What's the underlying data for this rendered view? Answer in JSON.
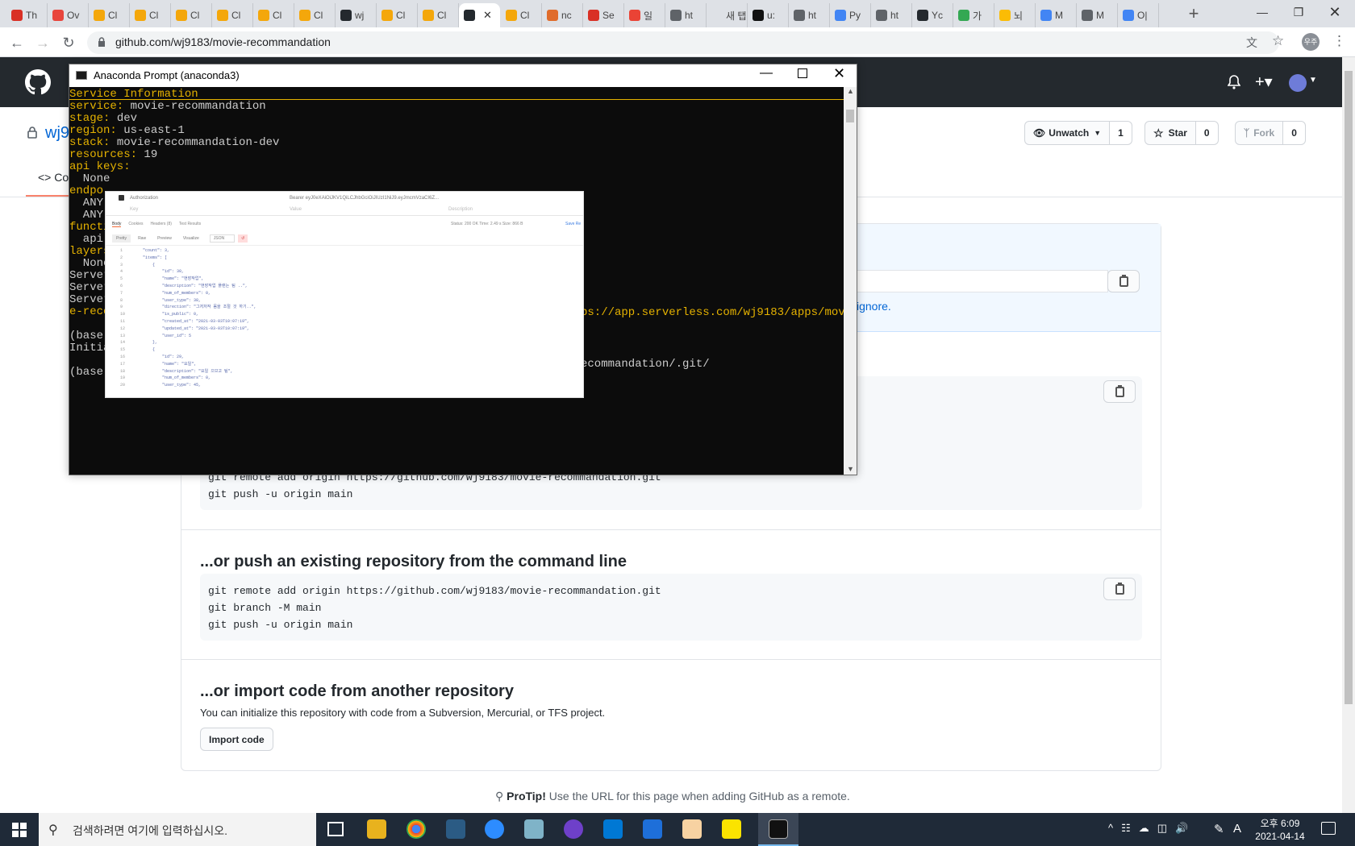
{
  "browser": {
    "tabs": [
      {
        "label": "Th",
        "color": "#d93025"
      },
      {
        "label": "Ov",
        "color": "#e8453c"
      },
      {
        "label": "Cl",
        "color": "#f4a70b"
      },
      {
        "label": "Cl",
        "color": "#f4a70b"
      },
      {
        "label": "Cl",
        "color": "#f4a70b"
      },
      {
        "label": "Cl",
        "color": "#f4a70b"
      },
      {
        "label": "Cl",
        "color": "#f4a70b"
      },
      {
        "label": "Cl",
        "color": "#f4a70b"
      },
      {
        "label": "wj",
        "color": "#24292e"
      },
      {
        "label": "Cl",
        "color": "#f4a70b"
      },
      {
        "label": "Cl",
        "color": "#f4a70b"
      },
      {
        "label": "",
        "color": "#24292e",
        "active": true
      },
      {
        "label": "Cl",
        "color": "#f4a70b"
      },
      {
        "label": "nc",
        "color": "#e06c2b"
      },
      {
        "label": "Se",
        "color": "#d93025"
      },
      {
        "label": "일",
        "color": "#ea4335"
      },
      {
        "label": "ht",
        "color": "#5f6368"
      },
      {
        "label": "새 탭",
        "color": "#dee1e6"
      },
      {
        "label": "u:",
        "color": "#111111"
      },
      {
        "label": "ht",
        "color": "#5f6368"
      },
      {
        "label": "Py",
        "color": "#4285f4"
      },
      {
        "label": "ht",
        "color": "#5f6368"
      },
      {
        "label": "Yc",
        "color": "#24292e"
      },
      {
        "label": "가",
        "color": "#34a853"
      },
      {
        "label": "뇌",
        "color": "#fbbc05"
      },
      {
        "label": "M",
        "color": "#4285f4"
      },
      {
        "label": "M",
        "color": "#5f6368"
      },
      {
        "label": "O|",
        "color": "#4285f4"
      }
    ],
    "url": "github.com/wj9183/movie-recommandation",
    "profile": "우주"
  },
  "repo": {
    "owner_partial": "wj9",
    "code_tab_partial": "Co",
    "watch_label": "Unwatch",
    "watch_count": "1",
    "star_label": "Star",
    "star_count": "0",
    "fork_label": "Fork",
    "fork_count": "0",
    "gitignore_link": "ignore."
  },
  "sections": {
    "new_repo_lines_visible": [
      "git remote add origin https://github.com/wj9183/movie-recommandation.git",
      "git push -u origin main"
    ],
    "push_existing": {
      "title": "...or push an existing repository from the command line",
      "lines": [
        "git remote add origin https://github.com/wj9183/movie-recommandation.git",
        "git branch -M main",
        "git push -u origin main"
      ]
    },
    "import": {
      "title": "...or import code from another repository",
      "desc": "You can initialize this repository with code from a Subversion, Mercurial, or TFS project.",
      "button": "Import code"
    },
    "protip_label": "ProTip!",
    "protip_text": " Use the URL for this page when adding GitHub as a remote."
  },
  "terminal": {
    "title": "Anaconda Prompt (anaconda3)",
    "lines": [
      {
        "k": "Service Information",
        "v": ""
      },
      {
        "k": "service:",
        "v": " movie-recommandation"
      },
      {
        "k": "stage:",
        "v": " dev"
      },
      {
        "k": "region:",
        "v": " us-east-1"
      },
      {
        "k": "stack:",
        "v": " movie-recommandation-dev"
      },
      {
        "k": "resources:",
        "v": " 19"
      },
      {
        "k": "api keys:",
        "v": ""
      },
      {
        "k": "",
        "v": "  None"
      },
      {
        "k": "endpo",
        "v": ""
      },
      {
        "k": "",
        "v": "  ANY"
      },
      {
        "k": "",
        "v": "  ANY"
      },
      {
        "k": "functi",
        "v": ""
      },
      {
        "k": "",
        "v": "  api:"
      },
      {
        "k": "layers",
        "v": ""
      },
      {
        "k": "",
        "v": "  None"
      },
      {
        "k": "",
        "v": "Server"
      },
      {
        "k": "",
        "v": "Server"
      },
      {
        "k": "",
        "v": "Server"
      },
      {
        "k": "e-reco",
        "v": ""
      },
      {
        "k": "",
        "v": ""
      },
      {
        "k": "",
        "v": "(base)"
      },
      {
        "k": "",
        "v": "Initia"
      },
      {
        "k": "",
        "v": ""
      },
      {
        "k": "",
        "v": "(base)"
      }
    ],
    "overflow_url": "ps://app.serverless.com/wj9183/apps/movi",
    "overflow_git": "ecommandation/.git/"
  },
  "postman": {
    "auth_label": "Authorization",
    "auth_value": "Bearer eyJ0eXAiOiJKV1QiLCJhbGciOiJIUzI1NiJ9.eyJmcmVzaCI6Z...",
    "col_key": "Key",
    "col_value": "Value",
    "col_desc": "Description",
    "tabs": [
      "Body",
      "Cookies",
      "Headers (8)",
      "Test Results"
    ],
    "status": "Status: 200 OK   Time: 2.49 s   Size: 866 B",
    "save": "Save Re",
    "view_tabs": [
      "Pretty",
      "Raw",
      "Preview",
      "Visualize"
    ],
    "format": "JSON",
    "json_lines": [
      "    \"count\": 3,",
      "    \"items\": [",
      "        {",
      "            \"id\": 30,",
      "            \"name\": \"현장작업\",",
      "            \"description\": \"현장작업 플랜는 팀 ..\",",
      "            \"num_of_members\": 0,",
      "            \"user_type\": 38,",
      "            \"direction\": \"그저저작 몸을 조절 것 하기..\",",
      "            \"is_public\": 0,",
      "            \"created_at\": \"2021-03-03T10:07:19\",",
      "            \"updated_at\": \"2021-03-03T10:07:19\",",
      "            \"user_id\": 5",
      "        },",
      "        {",
      "            \"id\": 29,",
      "            \"name\": \"요일\",",
      "            \"description\": \"요일 으므고 팀\",",
      "            \"num_of_members\": 0,",
      "            \"user_type\": 45,"
    ]
  },
  "taskbar": {
    "search_placeholder": "검색하려면 여기에 입력하십시오.",
    "time": "오후 6:09",
    "date": "2021-04-14",
    "ime": "A"
  }
}
